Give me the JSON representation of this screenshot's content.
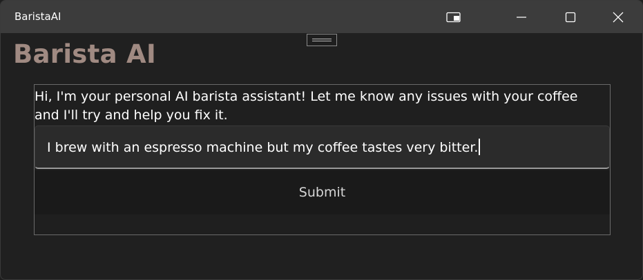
{
  "window": {
    "title": "BaristaAI",
    "controls": {
      "compact_overlay": "compact-overlay-icon",
      "minimize": "minimize-icon",
      "maximize": "maximize-icon",
      "close": "close-icon"
    }
  },
  "page": {
    "heading": "Barista AI",
    "heading_color": "#a08a82",
    "intro_text": "Hi, I'm your personal AI barista assistant! Let me know any issues with your coffee and I'll try and help you fix it.",
    "input": {
      "value": "I brew with an espresso machine but my coffee tastes very bitter."
    },
    "submit_label": "Submit"
  }
}
